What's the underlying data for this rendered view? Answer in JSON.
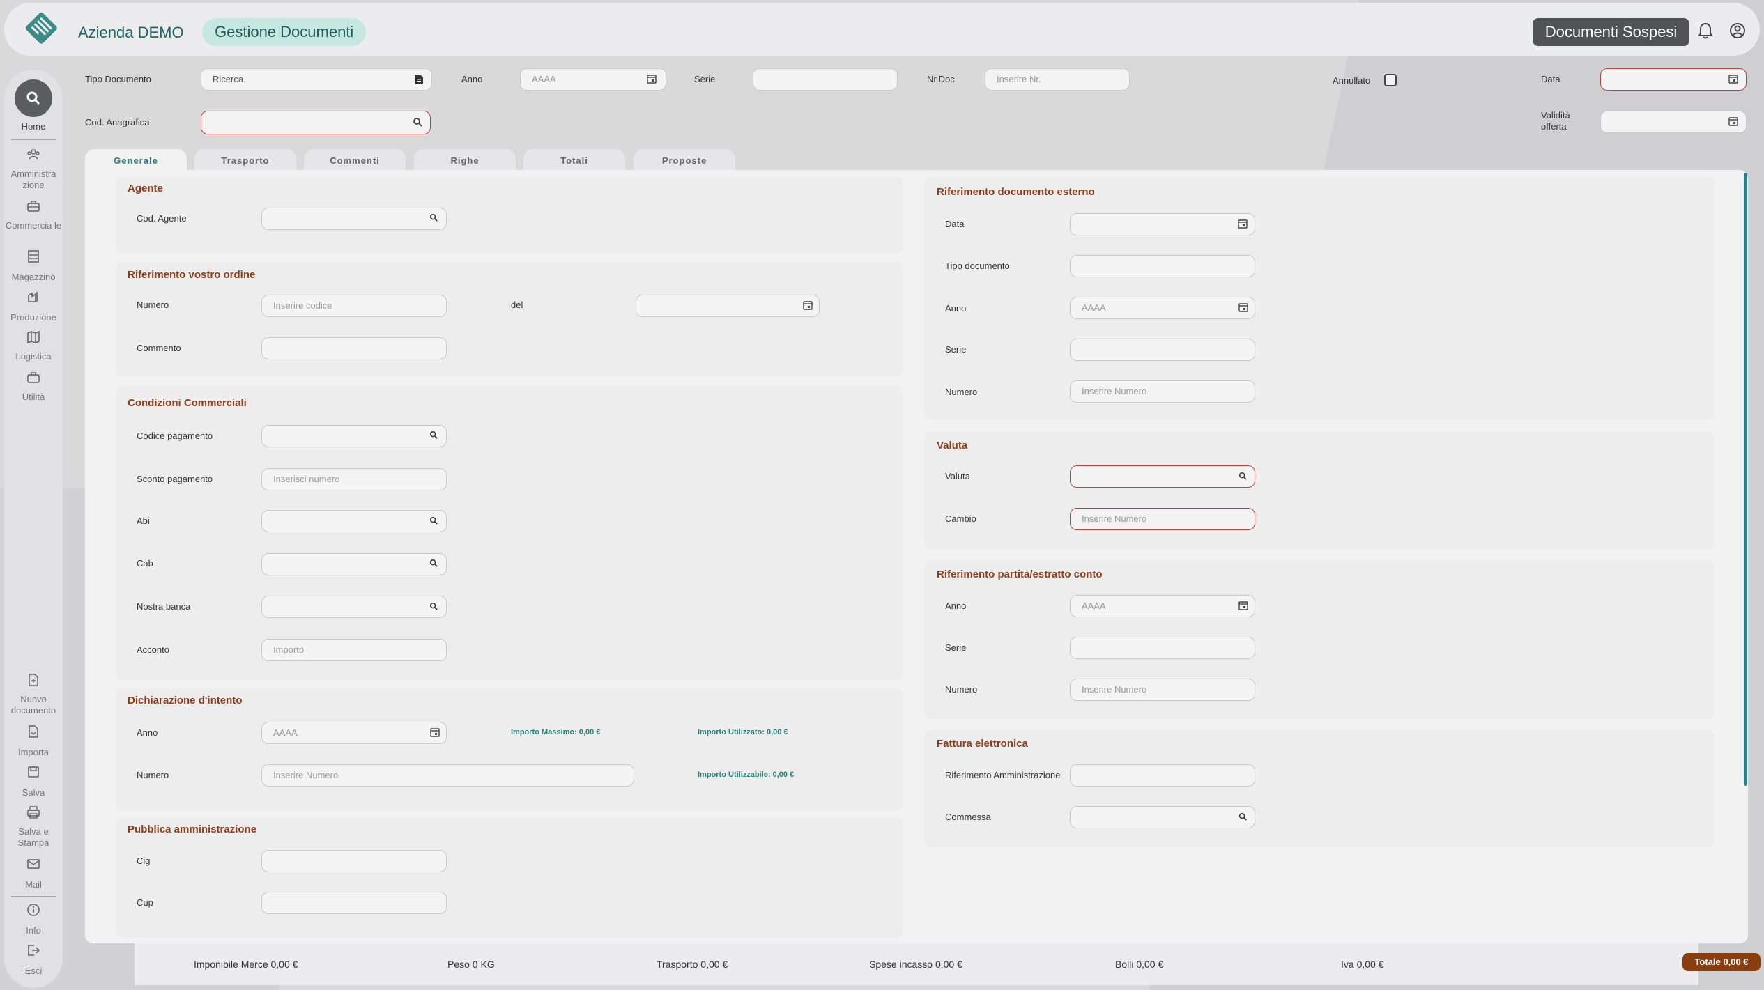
{
  "header": {
    "company": "Azienda DEMO",
    "app_title": "Gestione Documenti",
    "sospesi_label": "Documenti Sospesi"
  },
  "sidebar": {
    "items": [
      {
        "label": "Home"
      },
      {
        "label": "Amministra zione"
      },
      {
        "label": "Commercia le"
      },
      {
        "label": "Magazzino"
      },
      {
        "label": "Produzione"
      },
      {
        "label": "Logistica"
      },
      {
        "label": "Utilità"
      }
    ],
    "actions": [
      {
        "label": "Nuovo documento"
      },
      {
        "label": "Importa"
      },
      {
        "label": "Salva"
      },
      {
        "label": "Salva e Stampa"
      },
      {
        "label": "Mail"
      },
      {
        "label": "Info"
      },
      {
        "label": "Esci"
      }
    ]
  },
  "filters": {
    "tipo_documento": {
      "label": "Tipo Documento",
      "placeholder": "Ricerca."
    },
    "anno": {
      "label": "Anno",
      "placeholder": "AAAA"
    },
    "serie": {
      "label": "Serie",
      "placeholder": ""
    },
    "nrdoc": {
      "label": "Nr.Doc",
      "placeholder": "Inserire Nr."
    },
    "annullato": {
      "label": "Annullato"
    },
    "data": {
      "label": "Data"
    },
    "cod_anagrafica": {
      "label": "Cod. Anagrafica"
    },
    "validita": {
      "label": "Validità offerta"
    }
  },
  "tabs": [
    "Generale",
    "Trasporto",
    "Commenti",
    "Righe",
    "Totali",
    "Proposte"
  ],
  "left": {
    "agente": {
      "title": "Agente",
      "cod_agente": "Cod. Agente"
    },
    "rif_ordine": {
      "title": "Riferimento vostro ordine",
      "numero": "Numero",
      "numero_ph": "Inserire codice",
      "del": "del",
      "commento": "Commento"
    },
    "condizioni": {
      "title": "Condizioni Commerciali",
      "codice_pagamento": "Codice pagamento",
      "sconto": "Sconto pagamento",
      "sconto_ph": "Inserisci numero",
      "abi": "Abi",
      "cab": "Cab",
      "nostra_banca": "Nostra banca",
      "acconto": "Acconto",
      "acconto_ph": "Importo"
    },
    "dichiarazione": {
      "title": "Dichiarazione d'intento",
      "anno": "Anno",
      "anno_ph": "AAAA",
      "importo_massimo": "Importo Massimo: 0,00 €",
      "importo_utilizzato": "Importo Utilizzato: 0,00 €",
      "numero": "Numero",
      "numero_ph": "Inserire Numero",
      "importo_utilizzabile": "Importo Utilizzabile: 0,00 €"
    },
    "pubblica": {
      "title": "Pubblica amministrazione",
      "cig": "Cig",
      "cup": "Cup"
    }
  },
  "right": {
    "rif_esterno": {
      "title": "Riferimento documento esterno",
      "data": "Data",
      "tipo": "Tipo documento",
      "anno": "Anno",
      "anno_ph": "AAAA",
      "serie": "Serie",
      "numero": "Numero",
      "numero_ph": "Inserire Numero"
    },
    "valuta": {
      "title": "Valuta",
      "valuta": "Valuta",
      "cambio": "Cambio",
      "cambio_ph": "Inserire Numero"
    },
    "partita": {
      "title": "Riferimento partita/estratto conto",
      "anno": "Anno",
      "anno_ph": "AAAA",
      "serie": "Serie",
      "numero": "Numero",
      "numero_ph": "Inserire Numero"
    },
    "fattura": {
      "title": "Fattura elettronica",
      "rif_amm": "Riferimento Amministrazione",
      "commessa": "Commessa"
    }
  },
  "totals": {
    "imponibile": "Imponibile Merce 0,00 €",
    "peso": "Peso 0 KG",
    "trasporto": "Trasporto 0,00 €",
    "spese": "Spese incasso 0,00 €",
    "bolli": "Bolli 0,00 €",
    "iva": "Iva 0,00 €",
    "totale": "Totale 0,00 €"
  },
  "colors": {
    "accent": "#2a7a78",
    "brand_brown": "#8a3e1a",
    "error_border": "#b9453f"
  }
}
